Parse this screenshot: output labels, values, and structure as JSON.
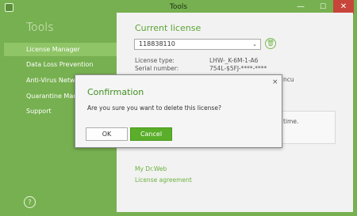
{
  "window": {
    "title": "Tools",
    "min_glyph": "—",
    "max_glyph": "☐",
    "close_glyph": "✕"
  },
  "sidebar": {
    "heading": "Tools",
    "items": [
      {
        "label": "License Manager",
        "active": true
      },
      {
        "label": "Data Loss Prevention",
        "active": false
      },
      {
        "label": "Anti-Virus Network",
        "active": false
      },
      {
        "label": "Quarantine Manager",
        "active": false
      },
      {
        "label": "Support",
        "active": false
      }
    ],
    "help_glyph": "?"
  },
  "content": {
    "heading": "Current license",
    "license_select": {
      "value": "118838110",
      "chevron": "⌄"
    },
    "delete_glyph": "🗑",
    "license_type_label": "License type:",
    "license_type_value": "LHW-_K-6M-1-A6",
    "serial_label": "Serial number:",
    "serial_value": "754L-$5FJ-****-****",
    "overflow_text": "ncu",
    "notice_text": "time.",
    "links": [
      "My Dr.Web",
      "License agreement"
    ]
  },
  "dialog": {
    "title": "Confirmation",
    "message": "Are you sure you want to delete this license?",
    "close_glyph": "×",
    "ok_label": "OK",
    "cancel_label": "Cancel"
  },
  "colors": {
    "accent_green": "#77b050",
    "cancel_button": "#5aae29",
    "close_button": "#c7453a",
    "title_text": "#3f8f20"
  }
}
